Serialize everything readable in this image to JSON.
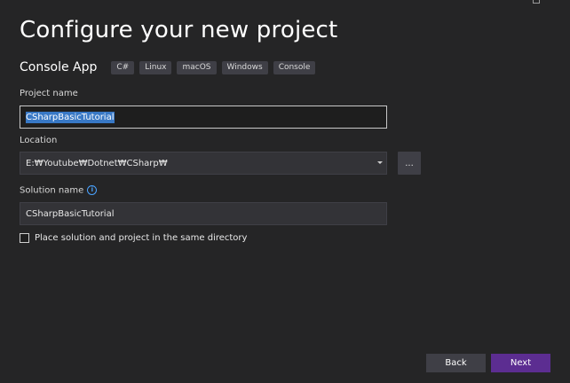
{
  "header": {
    "title": "Configure your new project"
  },
  "template": {
    "name": "Console App",
    "tags": [
      "C#",
      "Linux",
      "macOS",
      "Windows",
      "Console"
    ]
  },
  "project_name": {
    "label": "Project name",
    "value": "CSharpBasicTutorial"
  },
  "location": {
    "label": "Location",
    "value": "E:₩Youtube₩Dotnet₩CSharp₩",
    "browse_label": "..."
  },
  "solution_name": {
    "label": "Solution name",
    "info_glyph": "i",
    "value": "CSharpBasicTutorial"
  },
  "same_directory": {
    "label": "Place solution and project in the same directory",
    "checked": false
  },
  "footer": {
    "back_label": "Back",
    "next_label": "Next"
  },
  "colors": {
    "background": "#252526",
    "accent": "#5c2d91",
    "selection": "#3878c5",
    "info": "#4aa3ff"
  }
}
